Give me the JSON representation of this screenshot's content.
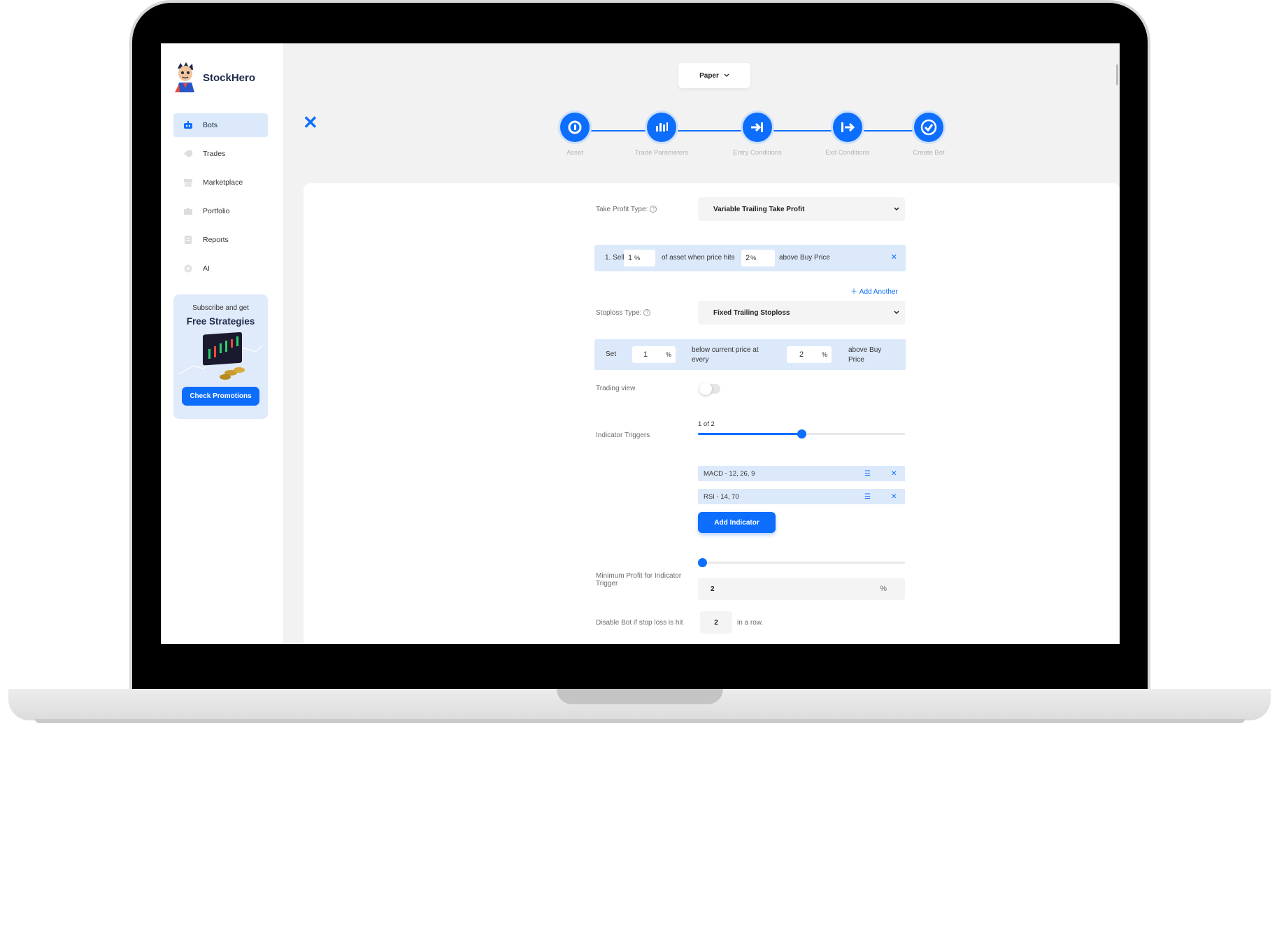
{
  "app": {
    "name": "StockHero"
  },
  "sidebar": {
    "items": [
      {
        "label": "Bots",
        "icon": "robot-icon",
        "active": true
      },
      {
        "label": "Trades",
        "icon": "tag-icon"
      },
      {
        "label": "Marketplace",
        "icon": "store-icon"
      },
      {
        "label": "Portfolio",
        "icon": "briefcase-icon"
      },
      {
        "label": "Reports",
        "icon": "report-icon"
      },
      {
        "label": "AI",
        "icon": "ai-icon"
      }
    ],
    "promo": {
      "subtitle": "Subscribe and get",
      "title": "Free Strategies",
      "button": "Check Promotions"
    }
  },
  "mode_dropdown": {
    "value": "Paper"
  },
  "steps": [
    {
      "label": "Asset",
      "icon": "asset-icon"
    },
    {
      "label": "Trade Parameters",
      "icon": "candles-icon"
    },
    {
      "label": "Entry Conditions",
      "icon": "entry-icon"
    },
    {
      "label": "Exit Conditions",
      "icon": "exit-icon"
    },
    {
      "label": "Create Bot",
      "icon": "check-icon"
    }
  ],
  "form": {
    "take_profit": {
      "label": "Take Profit Type:",
      "value": "Variable Trailing Take Profit",
      "row": {
        "prefix": "1. Sell",
        "sell_pct": "1",
        "unit": "%",
        "mid": "of asset when price hits",
        "hit_pct": "2",
        "suffix": "above Buy  Price"
      },
      "add_another": "Add Another"
    },
    "stoploss": {
      "label": "Stoploss Type:",
      "value": "Fixed Trailing Stoploss",
      "row": {
        "prefix": "Set",
        "pct": "1",
        "unit": "%",
        "mid": "below current price at every",
        "every_pct": "2",
        "suffix": "above Buy Price"
      }
    },
    "trading_view": {
      "label": "Trading view",
      "enabled": false
    },
    "indicator_triggers": {
      "label": "Indicator Triggers",
      "count_text": "1 of 2",
      "slider_fraction": 0.5,
      "indicators": [
        "MACD - 12, 26, 9",
        "RSI - 14, 70"
      ],
      "add_button": "Add Indicator"
    },
    "min_profit": {
      "label": "Minimum Profit for Indicator Trigger",
      "slider_fraction": 0.0,
      "value": "2",
      "unit": "%"
    },
    "disable_bot": {
      "prefix": "Disable Bot if stop loss is hit",
      "value": "2",
      "suffix": "in a row."
    }
  }
}
